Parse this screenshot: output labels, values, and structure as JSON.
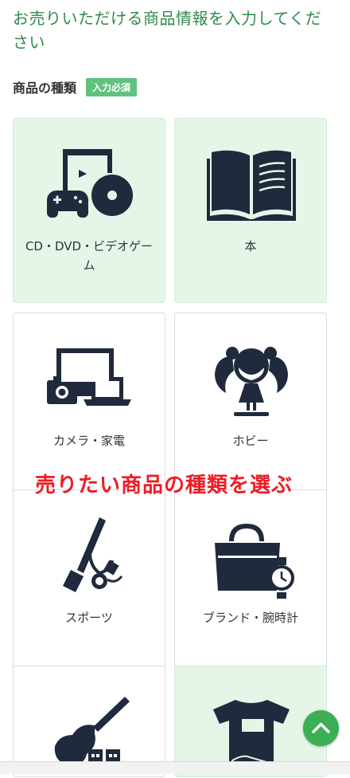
{
  "page": {
    "heading": "お売りいただける商品情報を入力してください",
    "section_label": "商品の種類",
    "required_badge": "入力必須",
    "overlay_caption": "売りたい商品の種類を選ぶ"
  },
  "categories": [
    {
      "label": "CD・DVD・ビデオゲーム",
      "icon": "media-gamepad-icon",
      "selected": true
    },
    {
      "label": "本",
      "icon": "book-icon",
      "selected": true
    },
    {
      "label": "カメラ・家電",
      "icon": "camera-electronics-icon",
      "selected": false
    },
    {
      "label": "ホビー",
      "icon": "figure-icon",
      "selected": false
    },
    {
      "label": "スポーツ",
      "icon": "sports-icon",
      "selected": false
    },
    {
      "label": "ブランド・腕時計",
      "icon": "bag-watch-icon",
      "selected": false
    },
    {
      "label": "",
      "icon": "guitar-icon",
      "selected": false
    },
    {
      "label": "",
      "icon": "tshirt-sneaker-icon",
      "selected": true
    }
  ],
  "colors": {
    "accent": "#2f8a4c",
    "badge": "#5fc27d",
    "selected_bg": "#e5f6e9",
    "icon": "#1f2a3c",
    "caption": "#ee1c24",
    "to_top": "#3cae54"
  },
  "to_top_icon": "chevron-up-icon"
}
